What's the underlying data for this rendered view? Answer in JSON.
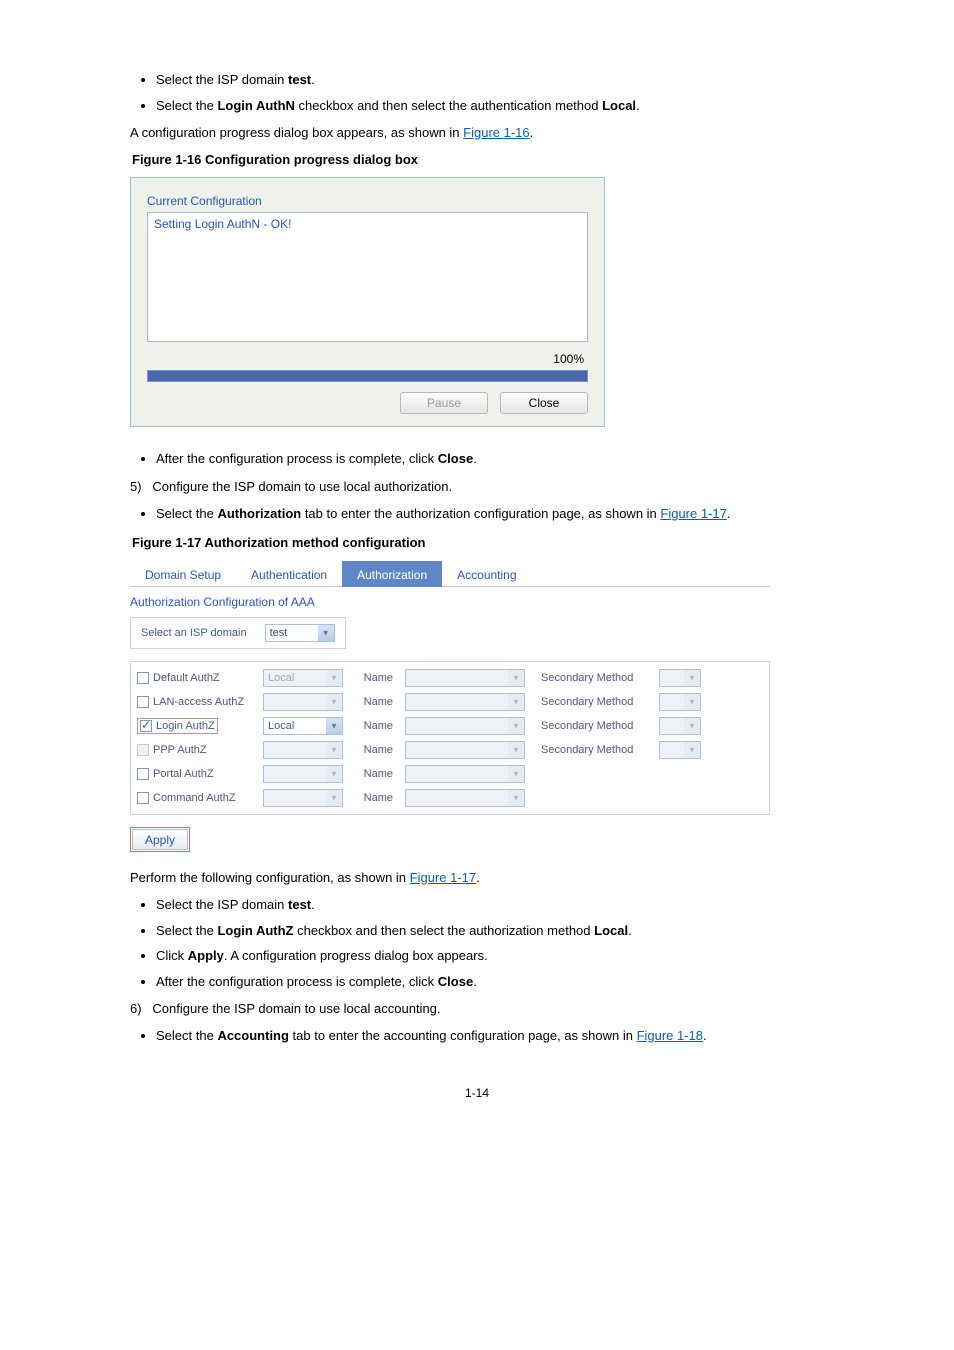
{
  "lists": {
    "a": [
      {
        "pre": "Select the ISP domain ",
        "bold": "test",
        "post": "."
      },
      {
        "pre": "Select the ",
        "bold": "Login AuthN",
        "post": " checkbox and then select the authentication method "
      }
    ],
    "a_item2_bold2": "Local",
    "a_item2_tail": ".",
    "figref_1_16": "Figure 1-16",
    "a_trailer_pre": "A configuration progress dialog box appears, as shown in ",
    "a_trailer_post": ".",
    "b": [
      {
        "pre": "After the configuration process is complete, click ",
        "bold": "Close",
        "post": "."
      }
    ],
    "step5": "Configure the ISP domain to use local authorization.",
    "b2_pre": "Select the ",
    "b2_bold": "Authorization",
    "b2_post": " tab to enter the authorization configuration page, as shown in ",
    "figref_1_17": "Figure 1-17",
    "b2_post2": ".",
    "c_lead": "Perform the following configuration, as shown in ",
    "figref_1_17b": "Figure 1-17",
    "c_lead_post": ".",
    "c": [
      {
        "pre": "Select the ISP domain ",
        "bold": "test",
        "post": "."
      },
      {
        "pre": "Select the ",
        "bold": "Login AuthZ",
        "post": " checkbox and then select the authorization method "
      },
      {
        "pre": "Click ",
        "bold": "Apply",
        "post": ". A configuration progress dialog box appears."
      },
      {
        "pre": "After the configuration process is complete, click ",
        "bold": "Close",
        "post": "."
      }
    ],
    "c_item2_bold2": "Local",
    "c_item2_tail": ".",
    "step6": "Configure the ISP domain to use local accounting.",
    "d_pre": "Select the ",
    "d_bold": "Accounting",
    "d_post": " tab to enter the accounting configuration page, as shown in ",
    "figref_1_18": "Figure 1-18",
    "d_post2": "."
  },
  "fig1_caption": "Figure 1-16 Configuration progress dialog box",
  "fig1": {
    "title": "Current Configuration",
    "output": "Setting Login AuthN - OK!",
    "percent": "100%",
    "pause": "Pause",
    "close": "Close"
  },
  "fig2_caption": "Figure 1-17 Authorization method configuration",
  "fig2": {
    "tabs": [
      "Domain Setup",
      "Authentication",
      "Authorization",
      "Accounting"
    ],
    "active_tab_index": 2,
    "section": "Authorization Configuration of AAA",
    "isp_label": "Select an ISP domain",
    "isp_value": "test",
    "cols": {
      "name": "Name",
      "sec": "Secondary Method"
    },
    "rows": [
      {
        "label": "Default AuthZ",
        "checked": false,
        "disabled": false,
        "dd1": "Local",
        "dd1_disabled": true,
        "name_dd": true,
        "sec": true
      },
      {
        "label": "LAN-access AuthZ",
        "checked": false,
        "disabled": false,
        "dd1": "",
        "dd1_disabled": true,
        "name_dd": true,
        "sec": true
      },
      {
        "label": "Login AuthZ",
        "checked": true,
        "disabled": false,
        "highlight": true,
        "dd1": "Local",
        "dd1_disabled": false,
        "name_dd": true,
        "sec": true
      },
      {
        "label": "PPP AuthZ",
        "checked": false,
        "disabled": true,
        "dd1": "",
        "dd1_disabled": true,
        "name_dd": true,
        "sec": true
      },
      {
        "label": "Portal AuthZ",
        "checked": false,
        "disabled": false,
        "dd1": "",
        "dd1_disabled": true,
        "name_dd": true,
        "sec": false
      },
      {
        "label": "Command AuthZ",
        "checked": false,
        "disabled": false,
        "dd1": "",
        "dd1_disabled": true,
        "name_dd": true,
        "sec": false
      }
    ],
    "apply": "Apply"
  },
  "page_no": "1-14"
}
